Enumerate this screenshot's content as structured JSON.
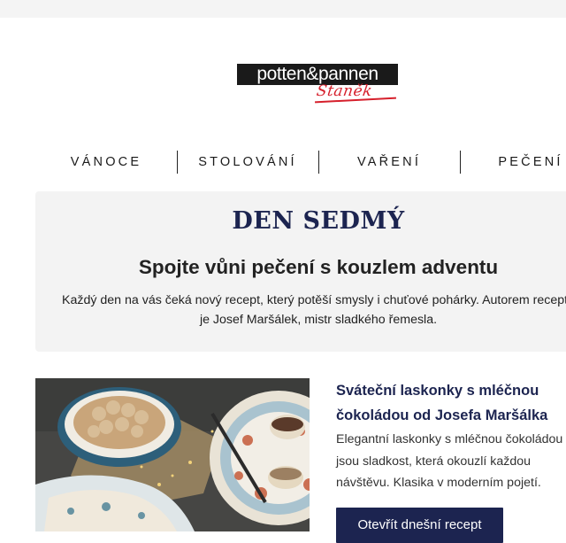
{
  "brand": {
    "logo_text": "potten&pannen",
    "logo_sub": "Staněk",
    "colors": {
      "accent": "#1c2450",
      "logo_red": "#d6202c",
      "panel": "#f3f3f3"
    }
  },
  "nav": {
    "items": [
      "VÁNOCE",
      "STOLOVÁNÍ",
      "VAŘENÍ",
      "PEČENÍ"
    ]
  },
  "hero": {
    "title": "DEN SEDMÝ",
    "subtitle": "Spojte vůni pečení s kouzlem adventu",
    "text": "Každý den na vás čeká nový recept, který potěší smysly i chuťové pohárky. Autorem receptů je Josef Maršálek, mistr sladkého řemesla."
  },
  "article": {
    "image_icon": "recipe-photo",
    "title": "Sváteční laskonky s mléčnou čokoládou od Josefa Maršálka",
    "text": "Elegantní laskonky s mléčnou čokoládou jsou sladkost, která okouzlí každou návštěvu. Klasika v moderním pojetí.",
    "cta_label": "Otevřít dnešní recept"
  }
}
